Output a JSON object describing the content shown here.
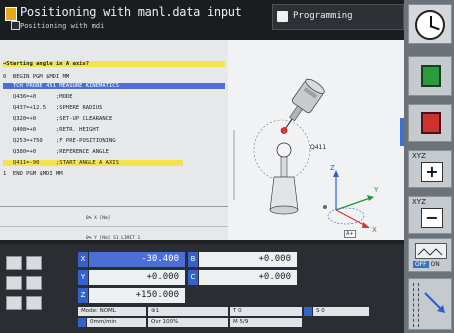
{
  "header": {
    "title": "Positioning with manl.data input",
    "subtitle": "Positioning with mdi",
    "program_tab": "Programming"
  },
  "program": {
    "lines": [
      "→Starting angle in A axis?",
      "0  BEGIN PGM $MDI MM",
      "   TCH PROBE 451 MEASURE KINEMATICS",
      "   Q436=+0      ;MODE",
      "   Q437=+12.5   ;SPHERE RADIUS",
      "   Q320=+0      ;SET-UP CLEARANCE",
      "   Q408=+0      ;RETR. HEIGHT",
      "   Q253=+750    ;F PRE-POSITIONING",
      "   Q380=+0      ;REFERENCE ANGLE",
      "   Q411=-90     ;START ANGLE A AXIS",
      "1  END PGM $MDI MM"
    ],
    "footer_a": "0% X [Nm]",
    "footer_b": "0% Y [Nm]  S1  LIMIT 1"
  },
  "graphic": {
    "callout": "Q411",
    "axis_z": "Z",
    "axis_y": "Y",
    "axis_x": "X",
    "axis_a": "A+"
  },
  "positions": {
    "rows": [
      {
        "axis1": "X",
        "value1": "-30.400",
        "axis2": "B",
        "value2": "+0.000"
      },
      {
        "axis1": "Y",
        "value1": "+0.000",
        "axis2": "C",
        "value2": "+0.000"
      },
      {
        "axis1": "Z",
        "value1": "+150.000"
      }
    ]
  },
  "status_info": {
    "mode_label": "Mode: NOML",
    "spindle_icon_val": "⊛1",
    "feed_label": "0mm/min",
    "override_label": "Ovr 100%",
    "t_label": "T 0",
    "s_label": "S 0",
    "m_label": "M 5/9"
  },
  "softkeys": {
    "xyz_plus_label": "XYZ",
    "plus_symbol": "+",
    "xyz_minus_label": "XYZ",
    "minus_symbol": "−",
    "off": "OFF",
    "on": "ON"
  }
}
